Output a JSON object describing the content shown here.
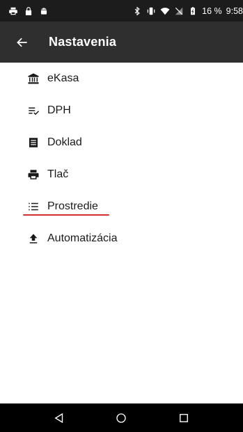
{
  "status_bar": {
    "battery": "16 %",
    "time": "9:58",
    "icons": [
      "printer-icon",
      "lock-icon",
      "android-icon",
      "bluetooth-icon",
      "vibrate-icon",
      "wifi-icon",
      "no-signal-icon",
      "battery-icon"
    ]
  },
  "toolbar": {
    "title": "Nastavenia",
    "back_icon": "arrow-back-icon"
  },
  "menu": {
    "items": [
      {
        "label": "eKasa",
        "icon": "bank-icon"
      },
      {
        "label": "DPH",
        "icon": "list-check-icon"
      },
      {
        "label": "Doklad",
        "icon": "receipt-icon"
      },
      {
        "label": "Tlač",
        "icon": "printer-icon"
      },
      {
        "label": "Prostredie",
        "icon": "list-icon",
        "highlighted": true
      },
      {
        "label": "Automatizácia",
        "icon": "upload-icon"
      }
    ]
  },
  "nav_bar": {
    "buttons": [
      "back-triangle-icon",
      "home-circle-icon",
      "recents-square-icon"
    ]
  },
  "colors": {
    "status_bar": "#1c1c1c",
    "toolbar": "#2f2f2f",
    "accent_underline": "#d32f2f",
    "nav_bar": "#000000"
  }
}
